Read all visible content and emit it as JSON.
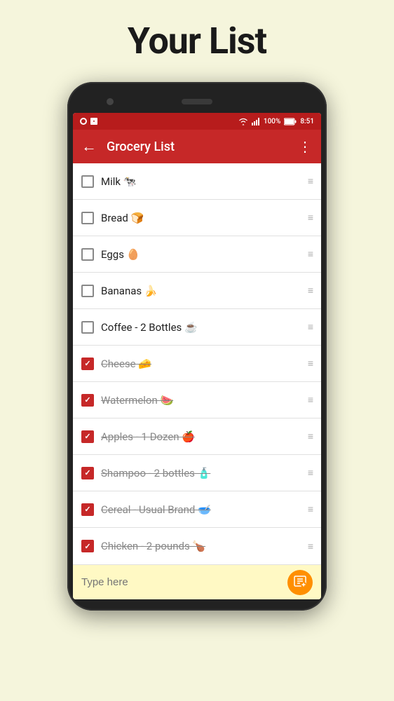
{
  "page": {
    "title": "Your List"
  },
  "status_bar": {
    "battery": "100%",
    "time": "8:51"
  },
  "toolbar": {
    "title": "Grocery List",
    "back_label": "←",
    "menu_label": "⋮"
  },
  "items": [
    {
      "id": 1,
      "label": "Milk 🐄",
      "checked": false
    },
    {
      "id": 2,
      "label": "Bread 🍞",
      "checked": false
    },
    {
      "id": 3,
      "label": "Eggs 🥚",
      "checked": false
    },
    {
      "id": 4,
      "label": "Bananas 🍌",
      "checked": false
    },
    {
      "id": 5,
      "label": "Coffee - 2 Bottles ☕",
      "checked": false
    },
    {
      "id": 6,
      "label": "Cheese 🧀",
      "checked": true
    },
    {
      "id": 7,
      "label": "Watermelon 🍉",
      "checked": true
    },
    {
      "id": 8,
      "label": "Apples - 1 Dozen 🍎",
      "checked": true
    },
    {
      "id": 9,
      "label": "Shampoo - 2 bottles 🧴",
      "checked": true
    },
    {
      "id": 10,
      "label": "Cereal - Usual Brand 🥣",
      "checked": true
    },
    {
      "id": 11,
      "label": "Chicken - 2 pounds 🍗",
      "checked": true
    }
  ],
  "bottom": {
    "placeholder": "Type here",
    "add_icon": "🗒"
  },
  "drag_handle": "≡"
}
